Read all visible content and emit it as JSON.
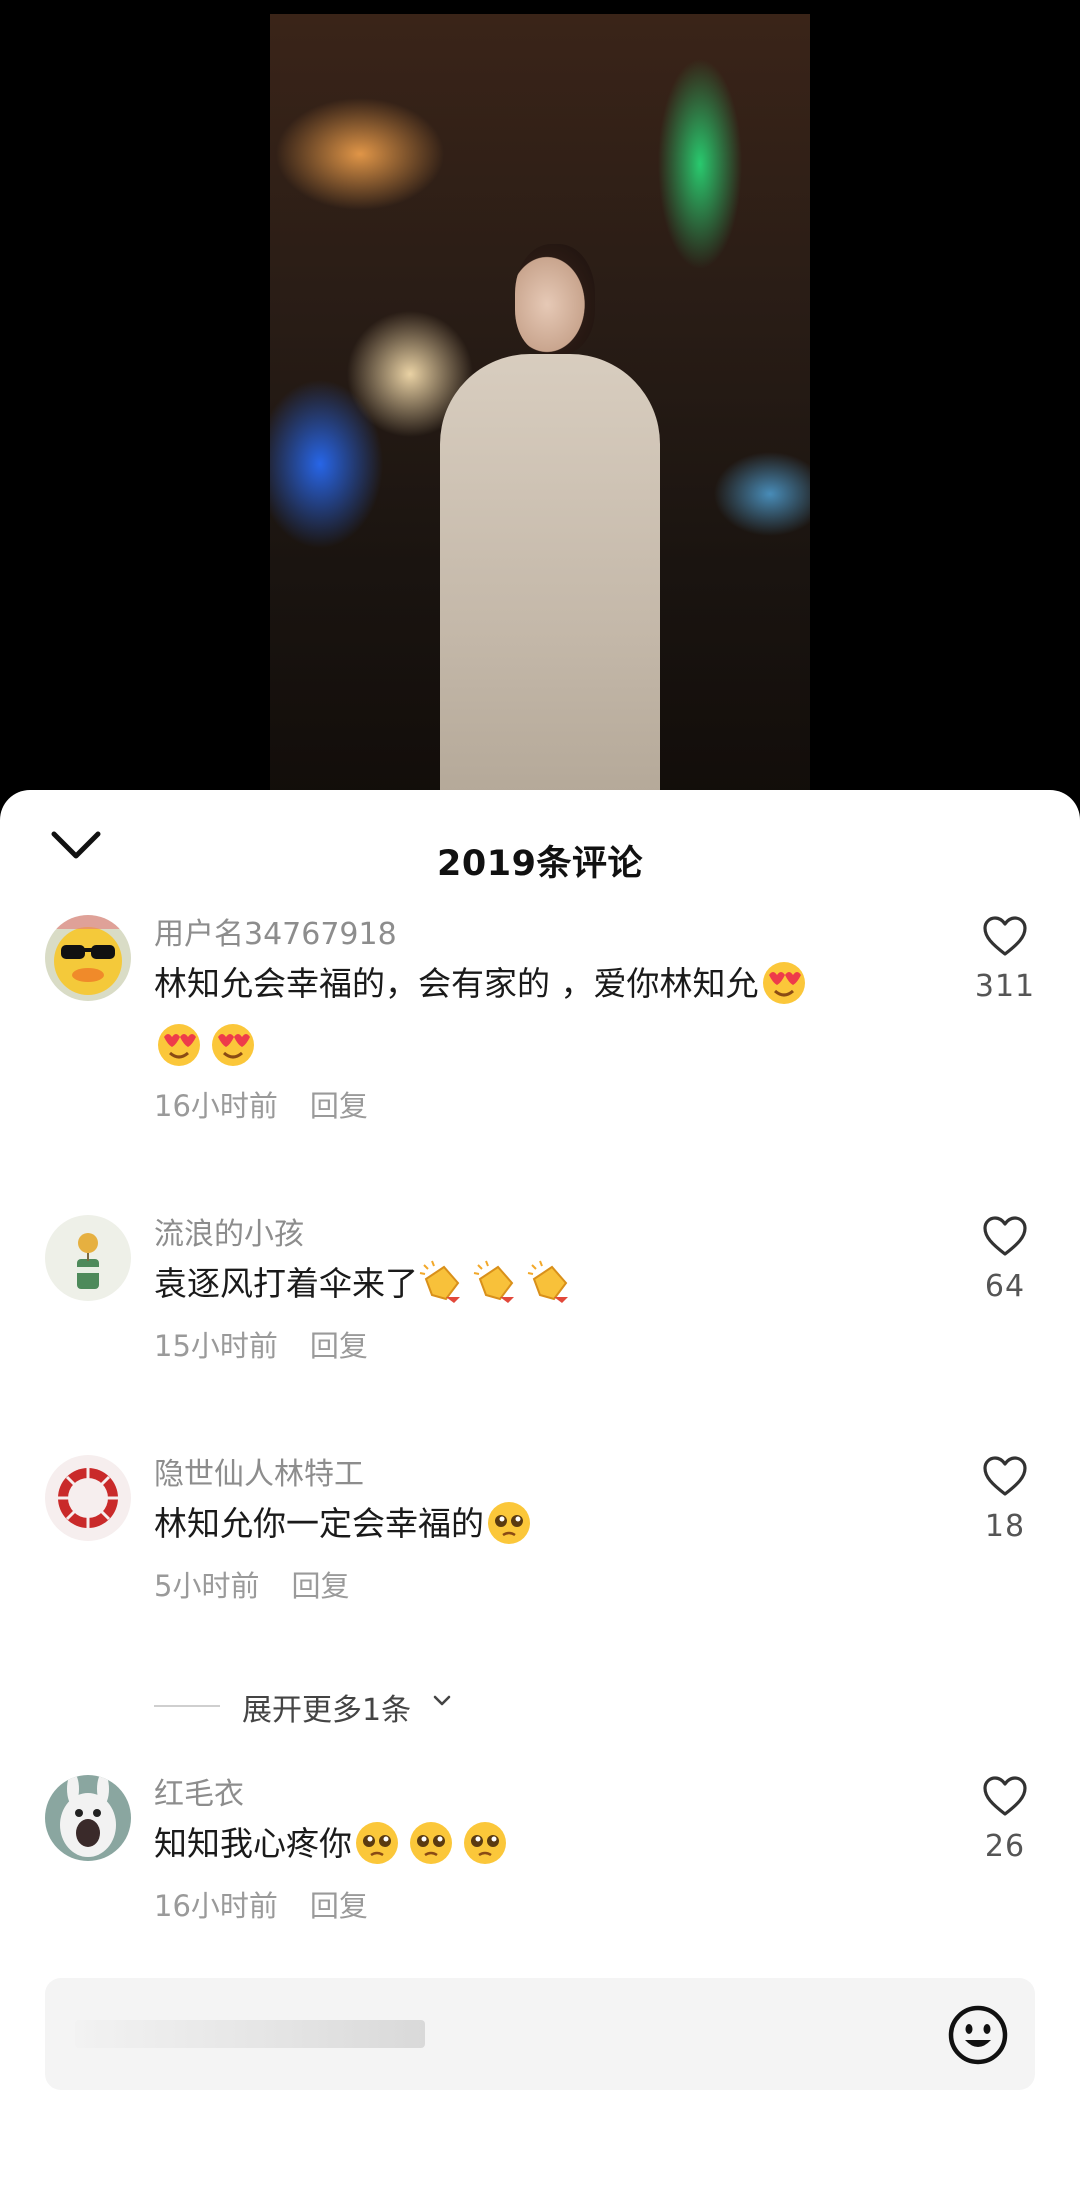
{
  "video": {
    "description_icon": "video-frame"
  },
  "sheet": {
    "title": "2019条评论",
    "collapse_icon": "chevron-down-icon"
  },
  "comments": [
    {
      "username": "用户名34767918",
      "text": "林知允会幸福的，会有家的 ，爱你林知允",
      "emojis": [
        "heart-eyes",
        "heart-eyes",
        "heart-eyes"
      ],
      "time": "16小时前",
      "reply": "回复",
      "likes": "311"
    },
    {
      "username": "流浪的小孩",
      "text": "袁逐风打着伞来了",
      "emojis": [
        "clap",
        "clap",
        "clap"
      ],
      "time": "15小时前",
      "reply": "回复",
      "likes": "64"
    },
    {
      "username": "隐世仙人林特工",
      "text": "林知允你一定会幸福的",
      "emojis": [
        "pleading"
      ],
      "time": "5小时前",
      "reply": "回复",
      "likes": "18"
    },
    {
      "username": "红毛衣",
      "text": "知知我心疼你",
      "emojis": [
        "pleading",
        "pleading",
        "pleading"
      ],
      "time": "16小时前",
      "reply": "回复",
      "likes": "26"
    }
  ],
  "expand_more": "展开更多1条",
  "input": {
    "emoji_icon": "smiley-icon"
  },
  "colors": {
    "sheet_bg": "#ffffff",
    "muted": "#9a9a9a",
    "background": "#000000"
  }
}
